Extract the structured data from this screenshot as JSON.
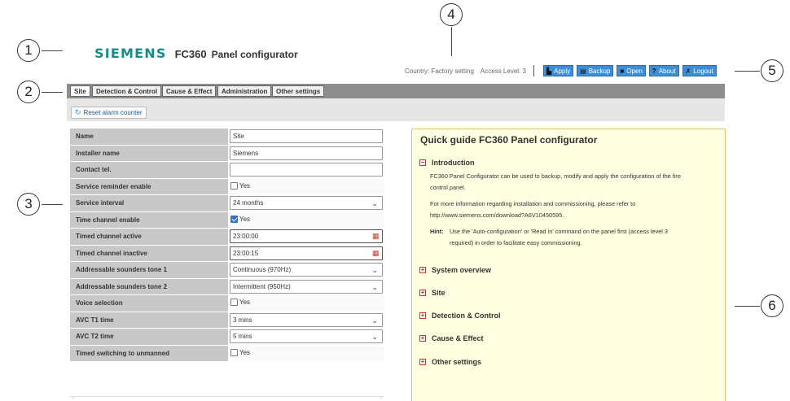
{
  "callouts": [
    "1",
    "2",
    "3",
    "4",
    "5",
    "6"
  ],
  "header": {
    "brand": "SIEMENS",
    "product": "FC360",
    "product_suffix": "Panel configurator",
    "country": "Country: Factory setting",
    "access_level": "Access Level: 3"
  },
  "toolbar": {
    "apply": "Apply",
    "backup": "Backup",
    "open": "Open",
    "about": "About",
    "logout": "Logout"
  },
  "tabs": [
    "Site",
    "Detection & Control",
    "Cause & Effect",
    "Administration",
    "Other settings"
  ],
  "subbar": {
    "reset_label": "Reset alarm counter"
  },
  "form": {
    "rows": [
      {
        "label": "Name",
        "value": "Site"
      },
      {
        "label": "Installer name",
        "value": "Siemens"
      },
      {
        "label": "Contact tel.",
        "value": ""
      },
      {
        "label": "Service reminder enable",
        "checkbox_label": "Yes",
        "checked": false
      },
      {
        "label": "Service interval",
        "value": "24 months"
      },
      {
        "label": "Time channel enable",
        "checkbox_label": "Yes",
        "checked": true
      },
      {
        "label": "Timed channel active",
        "value": "23:00:00"
      },
      {
        "label": "Timed channel inactive",
        "value": "23:00:15"
      },
      {
        "label": "Addressable sounders tone 1",
        "value": "Continuous (970Hz)"
      },
      {
        "label": "Addressable sounders tone 2",
        "value": "Intermittent (950Hz)"
      },
      {
        "label": "Voice selection",
        "checkbox_label": "Yes",
        "checked": false
      },
      {
        "label": "AVC T1 time",
        "value": "3 mins"
      },
      {
        "label": "AVC T2 time",
        "value": "5 mins"
      },
      {
        "label": "Timed switching to unmanned",
        "checkbox_label": "Yes",
        "checked": false
      }
    ]
  },
  "guide": {
    "title": "Quick guide FC360 Panel configurator",
    "intro_title": "Introduction",
    "intro_p1_l1": "FC360 Panel Configurator can be used to backup, modify and apply the configuration of the fire",
    "intro_p1_l2": "control panel.",
    "intro_p2_l1": "For more information regarding installation and commissioning, please refer to",
    "intro_p2_l2": "http://www.siemens.com/download?A6V10450595.",
    "hint_label": "Hint:",
    "hint_l1": "Use the 'Auto-configuration' or 'Read in' command on the panel first (access level 3",
    "hint_l2": "required) in order to facilitate easy commissioning.",
    "sections": [
      "System overview",
      "Site",
      "Detection & Control",
      "Cause & Effect",
      "Other settings"
    ]
  },
  "colors": {
    "brand": "#1b8a8a",
    "toolbar_button": "#3c8ed8",
    "guide_bg": "#fffee0",
    "guide_border": "#f2c26b",
    "checkbox_on": "#2f76d4"
  }
}
